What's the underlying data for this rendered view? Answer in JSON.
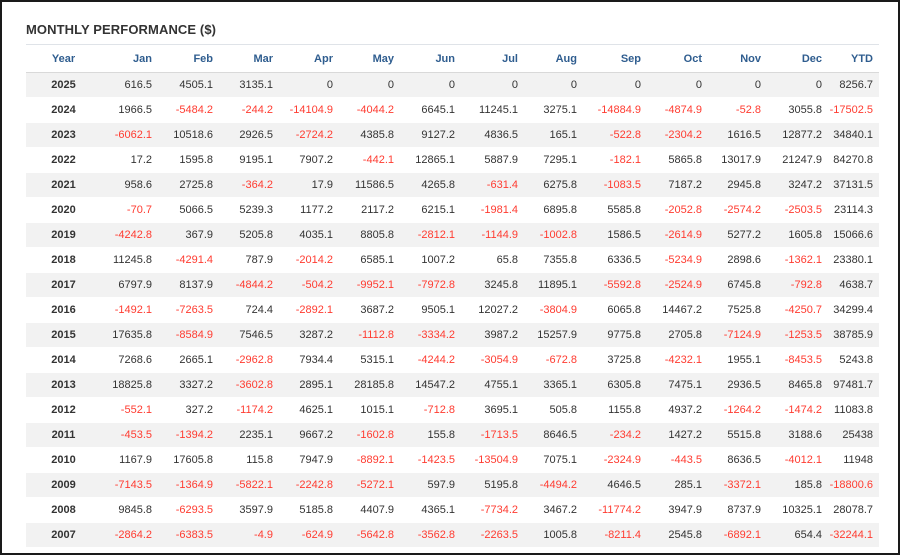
{
  "title": "MONTHLY PERFORMANCE ($)",
  "colors": {
    "header_text": "#2f5d8f",
    "negative": "#ff3b30",
    "positive": "#333333",
    "row_alt": "#f2f2f2"
  },
  "columns": [
    "Year",
    "Jan",
    "Feb",
    "Mar",
    "Apr",
    "May",
    "Jun",
    "Jul",
    "Aug",
    "Sep",
    "Oct",
    "Nov",
    "Dec",
    "YTD"
  ],
  "rows": [
    [
      "2025",
      "616.5",
      "4505.1",
      "3135.1",
      "0",
      "0",
      "0",
      "0",
      "0",
      "0",
      "0",
      "0",
      "0",
      "8256.7"
    ],
    [
      "2024",
      "1966.5",
      "-5484.2",
      "-244.2",
      "-14104.9",
      "-4044.2",
      "6645.1",
      "11245.1",
      "3275.1",
      "-14884.9",
      "-4874.9",
      "-52.8",
      "3055.8",
      "-17502.5"
    ],
    [
      "2023",
      "-6062.1",
      "10518.6",
      "2926.5",
      "-2724.2",
      "4385.8",
      "9127.2",
      "4836.5",
      "165.1",
      "-522.8",
      "-2304.2",
      "1616.5",
      "12877.2",
      "34840.1"
    ],
    [
      "2022",
      "17.2",
      "1595.8",
      "9195.1",
      "7907.2",
      "-442.1",
      "12865.1",
      "5887.9",
      "7295.1",
      "-182.1",
      "5865.8",
      "13017.9",
      "21247.9",
      "84270.8"
    ],
    [
      "2021",
      "958.6",
      "2725.8",
      "-364.2",
      "17.9",
      "11586.5",
      "4265.8",
      "-631.4",
      "6275.8",
      "-1083.5",
      "7187.2",
      "2945.8",
      "3247.2",
      "37131.5"
    ],
    [
      "2020",
      "-70.7",
      "5066.5",
      "5239.3",
      "1177.2",
      "2117.2",
      "6215.1",
      "-1981.4",
      "6895.8",
      "5585.8",
      "-2052.8",
      "-2574.2",
      "-2503.5",
      "23114.3"
    ],
    [
      "2019",
      "-4242.8",
      "367.9",
      "5205.8",
      "4035.1",
      "8805.8",
      "-2812.1",
      "-1144.9",
      "-1002.8",
      "1586.5",
      "-2614.9",
      "5277.2",
      "1605.8",
      "15066.6"
    ],
    [
      "2018",
      "11245.8",
      "-4291.4",
      "787.9",
      "-2014.2",
      "6585.1",
      "1007.2",
      "65.8",
      "7355.8",
      "6336.5",
      "-5234.9",
      "2898.6",
      "-1362.1",
      "23380.1"
    ],
    [
      "2017",
      "6797.9",
      "8137.9",
      "-4844.2",
      "-504.2",
      "-9952.1",
      "-7972.8",
      "3245.8",
      "11895.1",
      "-5592.8",
      "-2524.9",
      "6745.8",
      "-792.8",
      "4638.7"
    ],
    [
      "2016",
      "-1492.1",
      "-7263.5",
      "724.4",
      "-2892.1",
      "3687.2",
      "9505.1",
      "12027.2",
      "-3804.9",
      "6065.8",
      "14467.2",
      "7525.8",
      "-4250.7",
      "34299.4"
    ],
    [
      "2015",
      "17635.8",
      "-8584.9",
      "7546.5",
      "3287.2",
      "-1112.8",
      "-3334.2",
      "3987.2",
      "15257.9",
      "9775.8",
      "2705.8",
      "-7124.9",
      "-1253.5",
      "38785.9"
    ],
    [
      "2014",
      "7268.6",
      "2665.1",
      "-2962.8",
      "7934.4",
      "5315.1",
      "-4244.2",
      "-3054.9",
      "-672.8",
      "3725.8",
      "-4232.1",
      "1955.1",
      "-8453.5",
      "5243.8"
    ],
    [
      "2013",
      "18825.8",
      "3327.2",
      "-3602.8",
      "2895.1",
      "28185.8",
      "14547.2",
      "4755.1",
      "3365.1",
      "6305.8",
      "7475.1",
      "2936.5",
      "8465.8",
      "97481.7"
    ],
    [
      "2012",
      "-552.1",
      "327.2",
      "-1174.2",
      "4625.1",
      "1015.1",
      "-712.8",
      "3695.1",
      "505.8",
      "1155.8",
      "4937.2",
      "-1264.2",
      "-1474.2",
      "11083.8"
    ],
    [
      "2011",
      "-453.5",
      "-1394.2",
      "2235.1",
      "9667.2",
      "-1602.8",
      "155.8",
      "-1713.5",
      "8646.5",
      "-234.2",
      "1427.2",
      "5515.8",
      "3188.6",
      "25438"
    ],
    [
      "2010",
      "1167.9",
      "17605.8",
      "115.8",
      "7947.9",
      "-8892.1",
      "-1423.5",
      "-13504.9",
      "7075.1",
      "-2324.9",
      "-443.5",
      "8636.5",
      "-4012.1",
      "11948"
    ],
    [
      "2009",
      "-7143.5",
      "-1364.9",
      "-5822.1",
      "-2242.8",
      "-5272.1",
      "597.9",
      "5195.8",
      "-4494.2",
      "4646.5",
      "285.1",
      "-3372.1",
      "185.8",
      "-18800.6"
    ],
    [
      "2008",
      "9845.8",
      "-6293.5",
      "3597.9",
      "5185.8",
      "4407.9",
      "4365.1",
      "-7734.2",
      "3467.2",
      "-11774.2",
      "3947.9",
      "8737.9",
      "10325.1",
      "28078.7"
    ],
    [
      "2007",
      "-2864.2",
      "-6383.5",
      "-4.9",
      "-624.9",
      "-5642.8",
      "-3562.8",
      "-2263.5",
      "1005.8",
      "-8211.4",
      "2545.8",
      "-6892.1",
      "654.4",
      "-32244.1"
    ]
  ]
}
